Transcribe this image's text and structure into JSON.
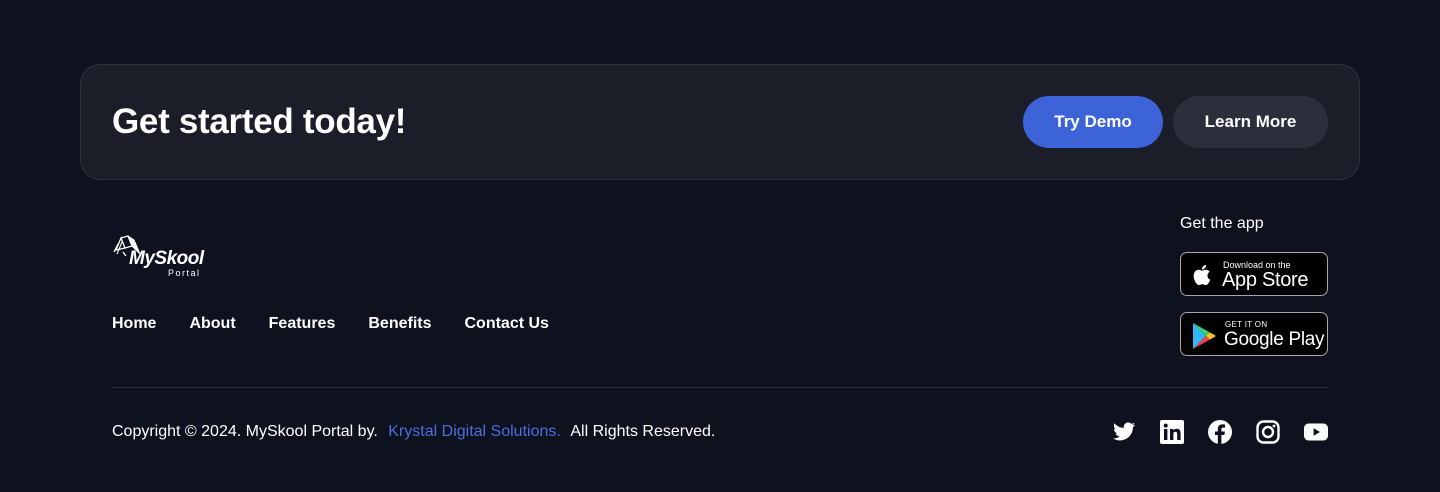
{
  "cta": {
    "title": "Get started today!",
    "primary_label": "Try Demo",
    "secondary_label": "Learn More"
  },
  "logo": {
    "name": "MySkool",
    "subtitle": "Portal"
  },
  "nav": {
    "items": [
      {
        "label": "Home"
      },
      {
        "label": "About"
      },
      {
        "label": "Features"
      },
      {
        "label": "Benefits"
      },
      {
        "label": "Contact Us"
      }
    ]
  },
  "app": {
    "heading": "Get the app",
    "apple_small": "Download on the",
    "apple_big": "App Store",
    "google_small": "GET IT ON",
    "google_big": "Google Play"
  },
  "footer": {
    "copyright_prefix": "Copyright © 2024. MySkool Portal by.",
    "company_link": "Krystal Digital Solutions.",
    "copyright_suffix": "All Rights Reserved."
  },
  "socials": [
    "twitter-icon",
    "linkedin-icon",
    "facebook-icon",
    "instagram-icon",
    "youtube-icon"
  ],
  "colors": {
    "background": "#0e111e",
    "card": "#1b1e29",
    "primary": "#3d63d8",
    "secondary": "#2b2f3b",
    "link": "#4a6fe0"
  }
}
